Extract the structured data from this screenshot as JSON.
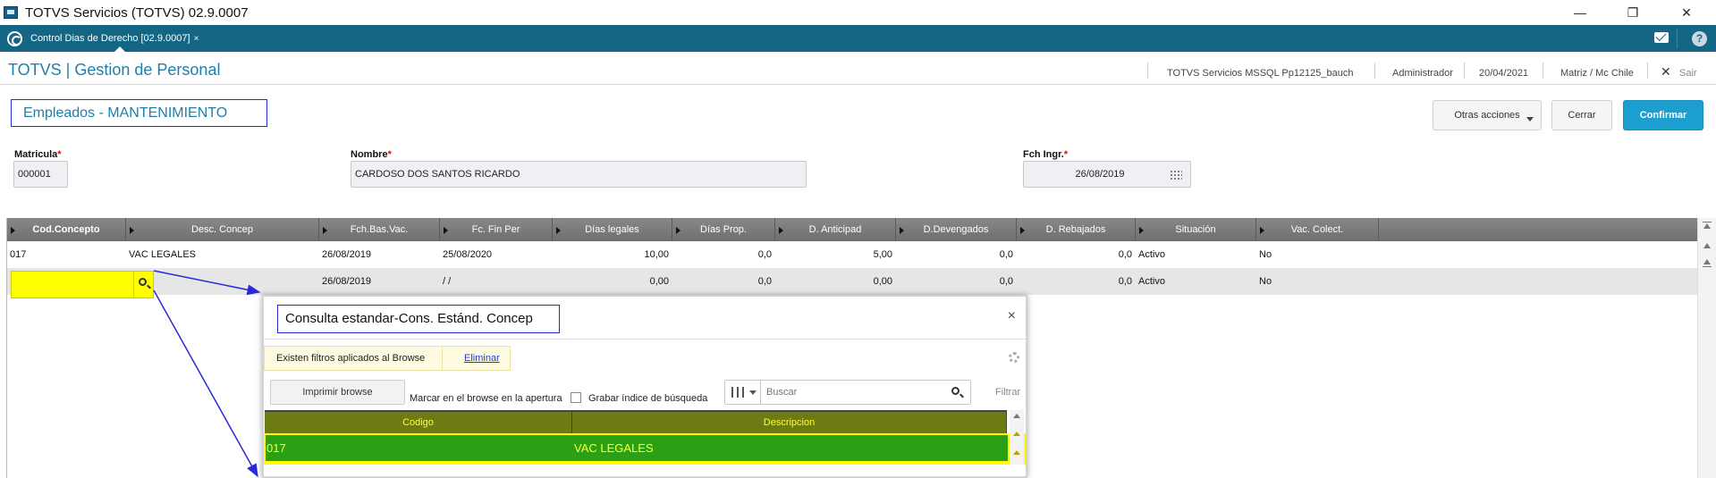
{
  "window": {
    "title": "TOTVS Servicios (TOTVS) 02.9.0007",
    "controls": {
      "minimize": "—",
      "maximize": "❐",
      "close": "✕"
    }
  },
  "app_tabs": {
    "active_tab": "Control Dias de Derecho [02.9.0007]",
    "close_glyph": "×"
  },
  "header": {
    "brand": "TOTVS | Gestion de Personal",
    "environment": "TOTVS Servicios MSSQL Pp12125_bauch",
    "user": "Administrador",
    "date": "20/04/2021",
    "branch": "Matriz / Mc Chile",
    "logout_glyph": "✕",
    "logout": "Sair"
  },
  "form": {
    "title": "Empleados - MANTENIMIENTO",
    "buttons": {
      "otras": "Otras acciones",
      "cerrar": "Cerrar",
      "confirmar": "Confirmar"
    },
    "required_mark": "*",
    "fields": {
      "matricula": {
        "label": "Matricula",
        "value": "000001"
      },
      "nombre": {
        "label": "Nombre",
        "value": "CARDOSO DOS SANTOS RICARDO"
      },
      "fch_ingr": {
        "label": "Fch Ingr.",
        "value": "26/08/2019"
      }
    }
  },
  "grid": {
    "columns": [
      "Cod.Concepto",
      "Desc. Concep",
      "Fch.Bas.Vac.",
      "Fc. Fin Per",
      "Días legales",
      "Días Prop.",
      "D. Anticipad",
      "D.Devengados",
      "D. Rebajados",
      "Situación",
      "Vac. Colect."
    ],
    "rows": [
      [
        "017",
        "VAC LEGALES",
        "26/08/2019",
        "25/08/2020",
        "10,00",
        "0,0",
        "5,00",
        "0,0",
        "0,0",
        "Activo",
        "No"
      ],
      [
        "",
        "",
        "26/08/2019",
        "/ /",
        "0,00",
        "0,0",
        "0,00",
        "0,0",
        "0,0",
        "Activo",
        "No"
      ]
    ]
  },
  "dialog": {
    "title": "Consulta estandar-Cons. Estánd. Concep",
    "close_glyph": "×",
    "filter_notice": "Existen filtros aplicados al Browse",
    "filter_link": "Eliminar",
    "print_button": "Imprimir browse",
    "mark_label": "Marcar en el browse en la apertura",
    "save_index_label": "Grabar índice de búsqueda",
    "search_placeholder": "Buscar",
    "filter_button": "Filtrar",
    "columns": [
      "Codigo",
      "Descripcion"
    ],
    "rows": [
      [
        "017",
        "VAC LEGALES"
      ]
    ]
  },
  "colors": {
    "app_bar": "#156685",
    "brand_text": "#1f7fa8",
    "primary_button": "#1d9ed1",
    "highlight_yellow": "#ffff00",
    "selected_row_green": "#2ca014",
    "annotation_blue": "#2a2ad8"
  },
  "icons": [
    "app-icon",
    "totvs-logo-icon",
    "mail-icon",
    "help-icon",
    "calendar-icon",
    "search-icon",
    "gear-icon",
    "columns-icon"
  ]
}
